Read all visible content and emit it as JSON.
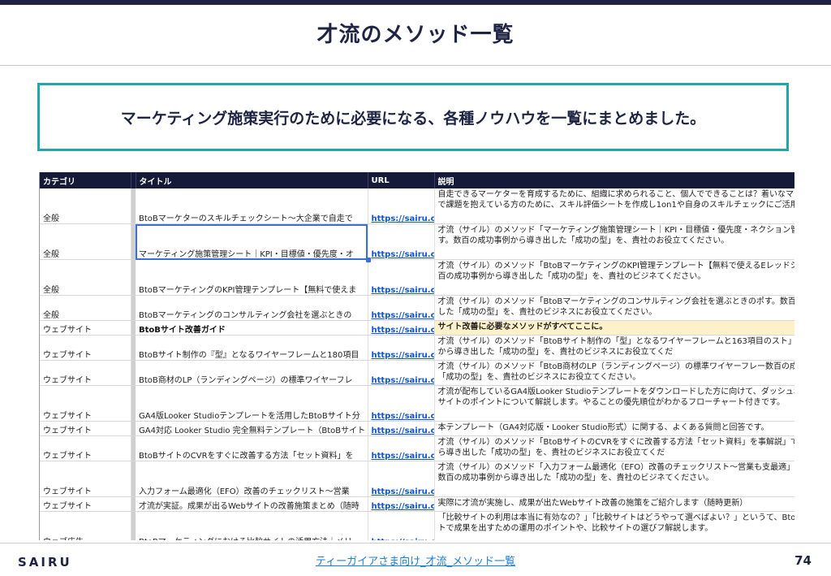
{
  "slide": {
    "title": "才流のメソッド一覧",
    "callout": "マーケティング施策実行のために必要になる、各種ノウハウを一覧にまとめました。",
    "brand": "SAIRU",
    "footer_link": "ティーガイアさま向け_才流_メソッド一覧",
    "page_number": "74"
  },
  "colors": {
    "header_bg": "#151a38",
    "accent_border": "#22a5ad",
    "highlight_row": "#fdf1c9",
    "link": "#1155cc"
  },
  "table": {
    "headers": {
      "category": "カテゴリ",
      "title": "タイトル",
      "url": "URL",
      "description": "説明"
    },
    "rows": [
      {
        "category": "全般",
        "title": "BtoBマーケターのスキルチェックシート〜大企業で自走で",
        "url": "https://sairu.co.jp",
        "description": "自走できるマーケターを育成するために、組織に求められること、個人でできることは？着いなマーケターのスキル評価で課題を抱えている方のために、スキル評価シートを作成し1on1や自身のスキルチェックにご活用ください。"
      },
      {
        "category": "全般",
        "title": "マーケティング施策管理シート｜KPI・目標値・優先度・オ",
        "url": "https://sairu.co.jp",
        "description": "才流（サイル）のメソッド「マーケティング施策管理シート｜KPI・目標値・優先度・ネクション管理・精緻の管理に」です。数百の成功事例から導き出した「成功の型」を、貴社のお役立てください。"
      },
      {
        "category": "全般",
        "title": "BtoBマーケティングのKPI管理テンプレート【無料で使えま",
        "url": "https://sairu.co.jp",
        "description": "才流（サイル）のメソッド「BtoBマーケティングのKPI管理テンプレート【無料で使えるEレッドシート付き】」です。数百の成功事例から導き出した「成功の型」を、貴社のビジネてください。"
      },
      {
        "category": "全般",
        "title": "BtoBマーケティングのコンサルティング会社を選ぶときの",
        "url": "https://sairu.co.jp",
        "description": "才流（サイル）のメソッド「BtoBマーケティングのコンサルティング会社を選ぶときのポす。数百の成功事例から導き出した「成功の型」を、貴社のビジネスにお役立てください。"
      },
      {
        "category": "ウェブサイト",
        "title": "BtoBサイト改善ガイド",
        "url": "https://sairu.co.jp",
        "description": "サイト改善に必要なメソッドがすべてここに。"
      },
      {
        "category": "ウェブサイト",
        "title": "BtoBサイト制作の『型』となるワイヤーフレームと180項目",
        "url": "https://sairu.co.jp",
        "description": "才流（サイル）のメソッド「BtoBサイト制作の「型」となるワイヤーフレームと163項目のスト」です。数百の成功事例から導き出した「成功の型」を、貴社のビジネスにお役立てくだ"
      },
      {
        "category": "ウェブサイト",
        "title": "BtoB商材のLP（ランディングページ）の標準ワイヤーフレ",
        "url": "https://sairu.co.jp",
        "description": "才流（サイル）のメソッド「BtoB商材のLP（ランディングページ）の標準ワイヤーフレー数百の成功事例から導き出した「成功の型」を、貴社のビジネスにお役立てください。"
      },
      {
        "category": "ウェブサイト",
        "title": "GA4版Looker Studioテンプレートを活用したBtoBサイト分",
        "url": "https://sairu.co.jp",
        "description": "才流が配布しているGA4版Looker Studioテンプレートをダウンロードした方に向けて、ダッシュボードを活用したBtoBサイトのポイントについて解説します。やることの優先順位がわかるフローチャート付きです。"
      },
      {
        "category": "ウェブサイト",
        "title": "GA4対応 Looker Studio 完全無料テンプレート（BtoBサイト",
        "url": "https://sairu.co.jp",
        "description": "本テンプレート（GA4対応版・Looker Studio形式）に関する、よくある質問と回答です。"
      },
      {
        "category": "ウェブサイト",
        "title": "BtoBサイトのCVRをすぐに改善する方法「セット資料」を",
        "url": "https://sairu.co.jp",
        "description": "才流（サイル）のメソッド「BtoBサイトのCVRをすぐに改善する方法「セット資料」を事解説」です。数百の成功事例から導き出した「成功の型」を、貴社のビジネスにお役立てくだ"
      },
      {
        "category": "ウェブサイト",
        "title": "入力フォーム最適化（EFO）改善のチェックリスト〜営業",
        "url": "https://sairu.co.jp",
        "description": "才流（サイル）のメソッド「入力フォーム最適化（EFO）改善のチェックリスト〜営業も支最適」のポイント〜」です。数百の成功事例から導き出した「成功の型」を、貴社のビジネてください。"
      },
      {
        "category": "ウェブサイト",
        "title": "才流が実証。成果が出るWebサイトの改善施策まとめ（随時",
        "url": "https://sairu.co.jp",
        "description": "実際に才流が実施し、成果が出たWebサイト改善の施策をご紹介します（随時更新）"
      },
      {
        "category": "ウェブ広告",
        "title": "BtoBマーケティングにおける比較サイトの活用方法｜メリ",
        "url": "https://sairu.co.jp",
        "description": "「比較サイトの利用は本当に有効なの？」「比較サイトはどうやって選べばよい？」というて、BtoBサービスの比較サイトで成果を出すための運用のポイントや、比較サイトの選びフ解説します。"
      }
    ]
  }
}
